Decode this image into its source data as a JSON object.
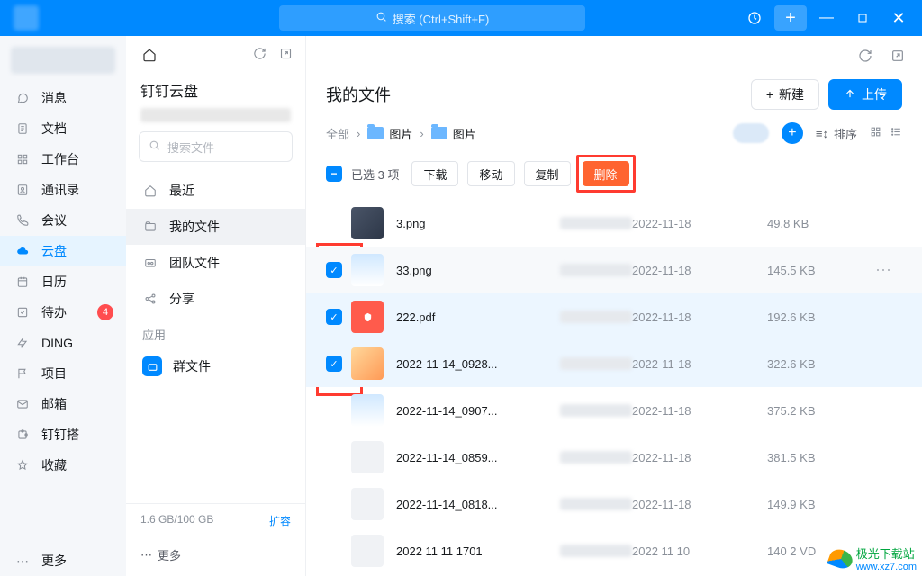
{
  "titlebar": {
    "search_placeholder": "搜索 (Ctrl+Shift+F)"
  },
  "leftnav": {
    "items": [
      {
        "icon": "chat",
        "label": "消息"
      },
      {
        "icon": "doc",
        "label": "文档"
      },
      {
        "icon": "grid",
        "label": "工作台"
      },
      {
        "icon": "contacts",
        "label": "通讯录"
      },
      {
        "icon": "phone",
        "label": "会议"
      },
      {
        "icon": "cloud",
        "label": "云盘",
        "active": true
      },
      {
        "icon": "calendar",
        "label": "日历"
      },
      {
        "icon": "todo",
        "label": "待办",
        "badge": "4"
      },
      {
        "icon": "ding",
        "label": "DING"
      },
      {
        "icon": "flag",
        "label": "项目"
      },
      {
        "icon": "mail",
        "label": "邮箱"
      },
      {
        "icon": "puzzle",
        "label": "钉钉搭"
      },
      {
        "icon": "star",
        "label": "收藏"
      }
    ],
    "more": "更多"
  },
  "midpanel": {
    "title": "钉钉云盘",
    "search_placeholder": "搜索文件",
    "items": [
      {
        "icon": "home",
        "label": "最近"
      },
      {
        "icon": "myfiles",
        "label": "我的文件",
        "active": true
      },
      {
        "icon": "team",
        "label": "团队文件"
      },
      {
        "icon": "share",
        "label": "分享"
      }
    ],
    "apps_label": "应用",
    "apps": [
      {
        "icon": "group",
        "label": "群文件"
      }
    ],
    "storage_used": "1.6 GB/100 GB",
    "storage_expand": "扩容",
    "more": "更多"
  },
  "content": {
    "title": "我的文件",
    "new_btn": "新建",
    "upload_btn": "上传",
    "breadcrumb": {
      "root": "全部",
      "p1": "图片",
      "p2": "图片"
    },
    "sort_label": "排序",
    "selection": {
      "count_label": "已选 3 项",
      "download": "下载",
      "move": "移动",
      "copy": "复制",
      "delete": "删除"
    },
    "files": [
      {
        "name": "3.png",
        "date": "2022-11-18",
        "size": "49.8 KB",
        "thumb": "img1",
        "checked": false
      },
      {
        "name": "33.png",
        "date": "2022-11-18",
        "size": "145.5 KB",
        "thumb": "img3",
        "checked": true,
        "hover": true
      },
      {
        "name": "222.pdf",
        "date": "2022-11-18",
        "size": "192.6 KB",
        "thumb": "pdf",
        "checked": true
      },
      {
        "name": "2022-11-14_0928...",
        "date": "2022-11-18",
        "size": "322.6 KB",
        "thumb": "img2",
        "checked": true
      },
      {
        "name": "2022-11-14_0907...",
        "date": "2022-11-18",
        "size": "375.2 KB",
        "thumb": "img3"
      },
      {
        "name": "2022-11-14_0859...",
        "date": "2022-11-18",
        "size": "381.5 KB",
        "thumb": "img4"
      },
      {
        "name": "2022-11-14_0818...",
        "date": "2022-11-18",
        "size": "149.9 KB",
        "thumb": "img4"
      },
      {
        "name": "2022 11 11 1701",
        "date": "2022 11 10",
        "size": "140 2 VD",
        "thumb": "img4"
      }
    ]
  },
  "watermark": {
    "brand": "极光下载站",
    "url": "www.xz7.com"
  }
}
